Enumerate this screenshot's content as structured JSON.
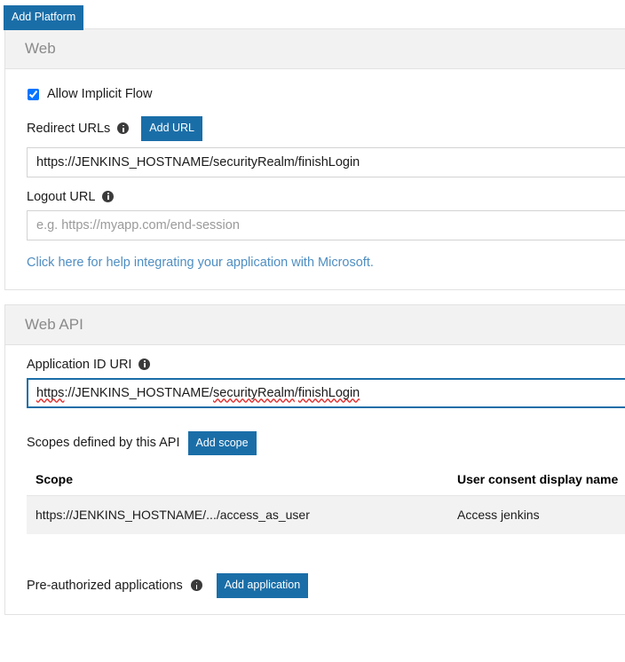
{
  "toolbar": {
    "add_platform_label": "Add Platform"
  },
  "web_panel": {
    "title": "Web",
    "allow_implicit_flow": {
      "label": "Allow Implicit Flow",
      "checked": true
    },
    "redirect_urls": {
      "label": "Redirect URLs",
      "info_icon": "info-icon",
      "add_button_label": "Add URL",
      "value": "https://JENKINS_HOSTNAME/securityRealm/finishLogin"
    },
    "logout_url": {
      "label": "Logout URL",
      "info_icon": "info-icon",
      "value": "",
      "placeholder": "e.g. https://myapp.com/end-session"
    },
    "help_link": "Click here for help integrating your application with Microsoft."
  },
  "web_api_panel": {
    "title": "Web API",
    "application_id_uri": {
      "label": "Application ID URI",
      "info_icon": "info-icon",
      "value": "https://JENKINS_HOSTNAME/securityRealm/finishLogin",
      "parts": [
        {
          "text": "https",
          "misspelled": true
        },
        {
          "text": "://JENKINS_HOSTNAME/",
          "misspelled": false
        },
        {
          "text": "securityRealm",
          "misspelled": true
        },
        {
          "text": "/",
          "misspelled": false
        },
        {
          "text": "finishLogin",
          "misspelled": true
        }
      ]
    },
    "scopes": {
      "label": "Scopes defined by this API",
      "add_button_label": "Add scope",
      "columns": [
        "Scope",
        "User consent display name"
      ],
      "rows": [
        {
          "scope": "https://JENKINS_HOSTNAME/.../access_as_user",
          "consent_name": "Access jenkins"
        }
      ]
    },
    "preauthorized": {
      "label": "Pre-authorized applications",
      "info_icon": "info-icon",
      "add_button_label": "Add application"
    }
  },
  "colors": {
    "accent": "#1a6ea8",
    "panel_header_bg": "#f2f2f2",
    "border": "#e2e2e2",
    "link": "#4f8ec2",
    "spellcheck_underline": "#e03030",
    "row_bg": "#f2f2f2"
  }
}
